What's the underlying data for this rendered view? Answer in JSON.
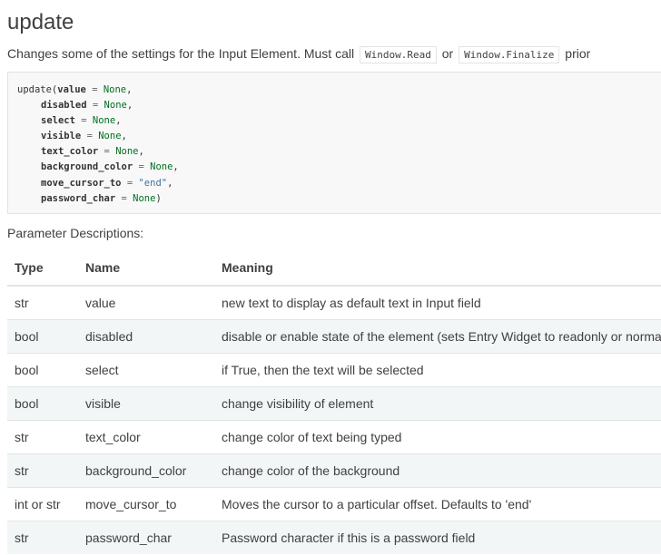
{
  "title": "update",
  "intro": {
    "text_before": "Changes some of the settings for the Input Element. Must call ",
    "code1": "Window.Read",
    "text_mid": " or ",
    "code2": "Window.Finalize",
    "text_after": " prior"
  },
  "code": {
    "func": "update(",
    "params": [
      {
        "name": "value",
        "value": "None",
        "value_kind": "none",
        "suffix": ","
      },
      {
        "name": "disabled",
        "value": "None",
        "value_kind": "none",
        "suffix": ","
      },
      {
        "name": "select",
        "value": "None",
        "value_kind": "none",
        "suffix": ","
      },
      {
        "name": "visible",
        "value": "None",
        "value_kind": "none",
        "suffix": ","
      },
      {
        "name": "text_color",
        "value": "None",
        "value_kind": "none",
        "suffix": ","
      },
      {
        "name": "background_color",
        "value": "None",
        "value_kind": "none",
        "suffix": ","
      },
      {
        "name": "move_cursor_to",
        "value": "\"end\"",
        "value_kind": "str",
        "suffix": ","
      },
      {
        "name": "password_char",
        "value": "None",
        "value_kind": "none",
        "suffix": ")"
      }
    ],
    "equals": " = "
  },
  "param_heading": "Parameter Descriptions:",
  "table": {
    "headers": [
      "Type",
      "Name",
      "Meaning"
    ],
    "rows": [
      {
        "type": "str",
        "name": "value",
        "meaning": "new text to display as default text in Input field"
      },
      {
        "type": "bool",
        "name": "disabled",
        "meaning": "disable or enable state of the element (sets Entry Widget to readonly or normal)"
      },
      {
        "type": "bool",
        "name": "select",
        "meaning": "if True, then the text will be selected"
      },
      {
        "type": "bool",
        "name": "visible",
        "meaning": "change visibility of element"
      },
      {
        "type": "str",
        "name": "text_color",
        "meaning": "change color of text being typed"
      },
      {
        "type": "str",
        "name": "background_color",
        "meaning": "change color of the background"
      },
      {
        "type": "int or str",
        "name": "move_cursor_to",
        "meaning": "Moves the cursor to a particular offset. Defaults to 'end'"
      },
      {
        "type": "str",
        "name": "password_char",
        "meaning": "Password character if this is a password field"
      }
    ]
  }
}
